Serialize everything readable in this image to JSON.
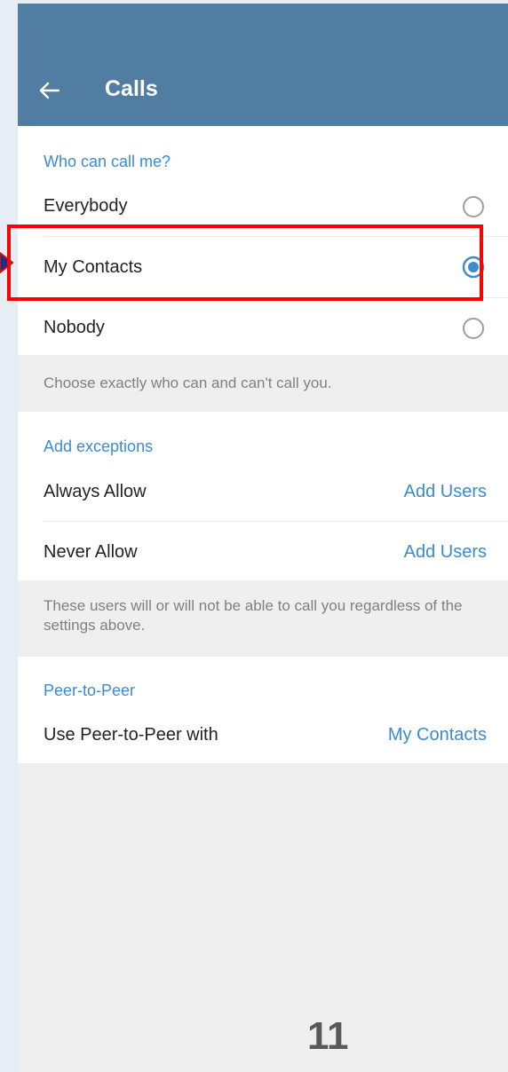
{
  "header": {
    "title": "Calls",
    "background": "#527da3"
  },
  "who_can_call": {
    "section_title": "Who can call me?",
    "options": [
      {
        "label": "Everybody",
        "selected": false
      },
      {
        "label": "My Contacts",
        "selected": true
      },
      {
        "label": "Nobody",
        "selected": false
      }
    ],
    "hint": "Choose exactly who can and can't call you."
  },
  "exceptions": {
    "section_title": "Add exceptions",
    "rows": [
      {
        "label": "Always Allow",
        "action": "Add Users"
      },
      {
        "label": "Never Allow",
        "action": "Add Users"
      }
    ],
    "hint": "These users will or will not be able to call you regardless of the settings above."
  },
  "peer_to_peer": {
    "section_title": "Peer-to-Peer",
    "row": {
      "label": "Use Peer-to-Peer with",
      "action": "My Contacts"
    }
  },
  "annotation": {
    "page_number": "11",
    "highlight_color": "#ff0000"
  },
  "colors": {
    "accent": "#3a8ccf",
    "background": "#efefef"
  }
}
